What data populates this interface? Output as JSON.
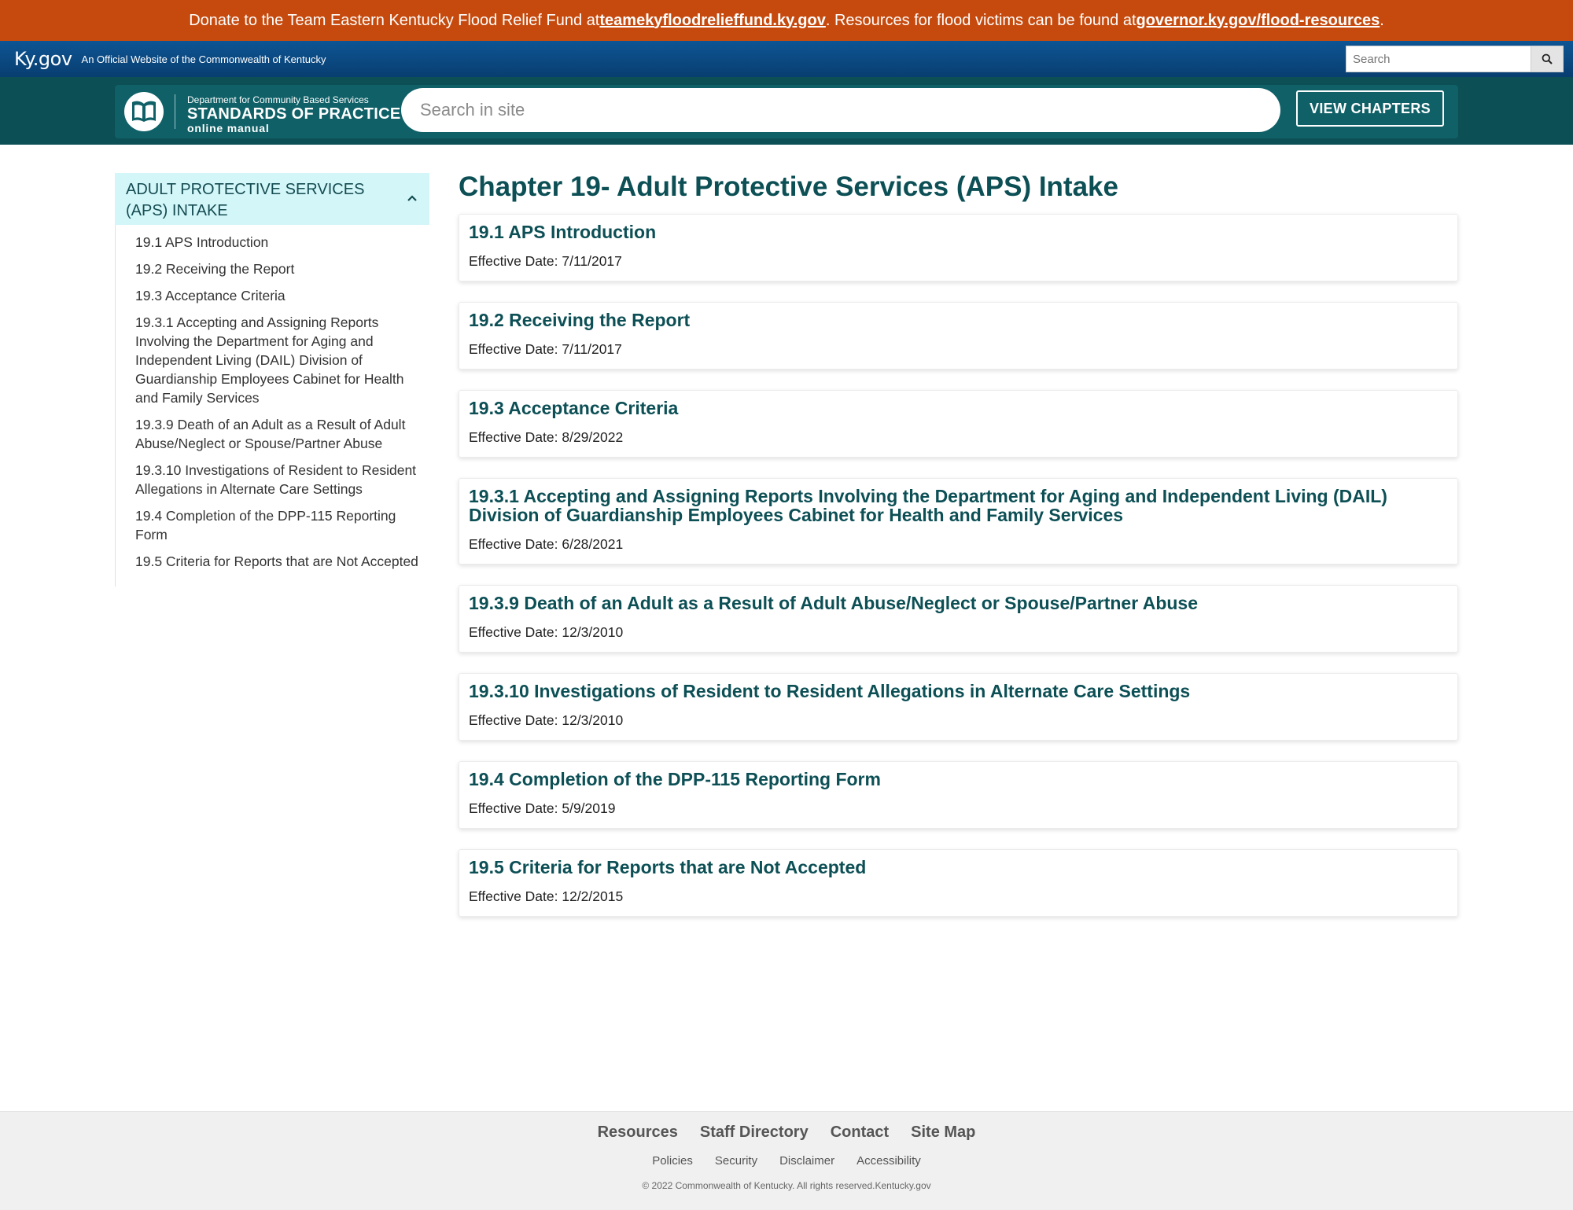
{
  "alert": {
    "text1": "Donate to the Team Eastern Kentucky Flood Relief Fund at ",
    "link1": "teamekyfloodrelieffund.ky.gov",
    "text2": ". Resources for flood victims can be found at ",
    "link2": "governor.ky.gov/flood-resources",
    "text3": "."
  },
  "kygov": {
    "logo": "Ky.gov",
    "tagline": "An Official Website of the Commonwealth of Kentucky",
    "search_placeholder": "Search",
    "search_icon": "search-icon"
  },
  "header": {
    "dept": "Department for Community Based Services",
    "title": "STANDARDS OF PRACTICE",
    "subtitle": "online manual",
    "search_placeholder": "Search in site",
    "view_chapters_label": "VIEW CHAPTERS",
    "logo_icon": "open-book-icon"
  },
  "sidebar": {
    "title": "ADULT PROTECTIVE SERVICES (APS) INTAKE",
    "toggle_icon": "chevron-up-icon",
    "items": [
      {
        "label": "19.1 APS Introduction"
      },
      {
        "label": "19.2 Receiving the Report"
      },
      {
        "label": "19.3 Acceptance Criteria"
      },
      {
        "label": "19.3.1 Accepting and Assigning Reports Involving the Department for Aging and Independent Living (DAIL) Division of Guardianship Employees Cabinet for Health and Family Services"
      },
      {
        "label": "19.3.9 Death of an Adult as a Result of Adult Abuse/Neglect or Spouse/Partner Abuse"
      },
      {
        "label": "19.3.10 Investigations of Resident to Resident Allegations in Alternate Care Settings"
      },
      {
        "label": "19.4 Completion of the DPP-115 Reporting Form"
      },
      {
        "label": "19.5 Criteria for Reports that are Not Accepted"
      }
    ]
  },
  "main": {
    "title": "Chapter 19- Adult Protective Services (APS) Intake",
    "cards": [
      {
        "title": "19.1 APS Introduction",
        "date": "Effective Date: 7/11/2017"
      },
      {
        "title": "19.2 Receiving the Report",
        "date": "Effective Date: 7/11/2017"
      },
      {
        "title": "19.3 Acceptance Criteria",
        "date": "Effective Date: 8/29/2022"
      },
      {
        "title": "19.3.1 Accepting and Assigning Reports Involving the Department for Aging and Independent Living (DAIL) Division of Guardianship Employees Cabinet for Health and Family Services",
        "date": "Effective Date: 6/28/2021"
      },
      {
        "title": "19.3.9 Death of an Adult as a Result of Adult Abuse/Neglect or Spouse/Partner Abuse",
        "date": "Effective Date: 12/3/2010"
      },
      {
        "title": "19.3.10 Investigations of Resident to Resident Allegations in Alternate Care Settings",
        "date": "Effective Date: 12/3/2010"
      },
      {
        "title": "19.4 Completion of the DPP-115 Reporting Form",
        "date": "Effective Date: 5/9/2019"
      },
      {
        "title": "19.5 Criteria for Reports that are Not Accepted",
        "date": "Effective Date: 12/2/2015"
      }
    ]
  },
  "footer": {
    "main_links": [
      "Resources",
      "Staff Directory",
      "Contact",
      "Site Map"
    ],
    "sub_links": [
      "Policies",
      "Security",
      "Disclaimer",
      "Accessibility"
    ],
    "copyright": "© 2022 Commonwealth of Kentucky. All rights reserved.Kentucky.gov"
  },
  "colors": {
    "alert_bg": "#c64a0e",
    "kygov_bar": "#0e5594",
    "header_teal": "#0c4f55",
    "sidebar_active_bg": "#d3f6f8",
    "heading_teal": "#0c4f55"
  }
}
